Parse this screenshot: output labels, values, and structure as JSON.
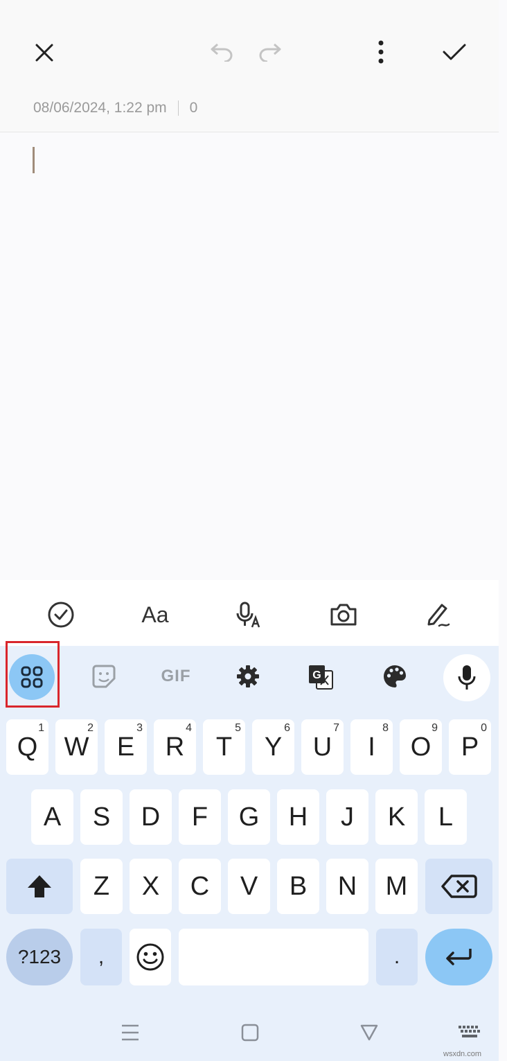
{
  "header": {
    "close_icon": "close-icon",
    "undo_icon": "undo-icon",
    "redo_icon": "redo-icon",
    "more_icon": "more-vertical-icon",
    "save_icon": "check-icon",
    "timestamp": "08/06/2024, 1:22 pm",
    "char_count": "0"
  },
  "edit_toolbar": {
    "items": [
      "checkbox-icon",
      "text-format-icon",
      "voice-recording-icon",
      "camera-icon",
      "handwriting-icon"
    ],
    "text_format_label": "Aa"
  },
  "keyboard": {
    "suggestion_bar": {
      "items": [
        "apps-grid-icon",
        "sticker-icon",
        "gif-icon",
        "settings-icon",
        "translate-icon",
        "palette-icon",
        "microphone-icon"
      ],
      "gif_label": "GIF"
    },
    "row1": [
      {
        "k": "Q",
        "h": "1"
      },
      {
        "k": "W",
        "h": "2"
      },
      {
        "k": "E",
        "h": "3"
      },
      {
        "k": "R",
        "h": "4"
      },
      {
        "k": "T",
        "h": "5"
      },
      {
        "k": "Y",
        "h": "6"
      },
      {
        "k": "U",
        "h": "7"
      },
      {
        "k": "I",
        "h": "8"
      },
      {
        "k": "O",
        "h": "9"
      },
      {
        "k": "P",
        "h": "0"
      }
    ],
    "row2": [
      "A",
      "S",
      "D",
      "F",
      "G",
      "H",
      "J",
      "K",
      "L"
    ],
    "row3": [
      "Z",
      "X",
      "C",
      "V",
      "B",
      "N",
      "M"
    ],
    "symbols_label": "?123",
    "comma_label": ",",
    "period_label": "."
  },
  "navigation": [
    "recents-icon",
    "home-icon",
    "back-icon",
    "keyboard-switch-icon"
  ],
  "watermark": "wsxdn.com",
  "colors": {
    "accent": "#8cc7f5",
    "key": "#ffffff",
    "mod_key": "#d4e2f7",
    "keyboard_bg": "#e8f0fb",
    "highlight": "#d9262c"
  }
}
